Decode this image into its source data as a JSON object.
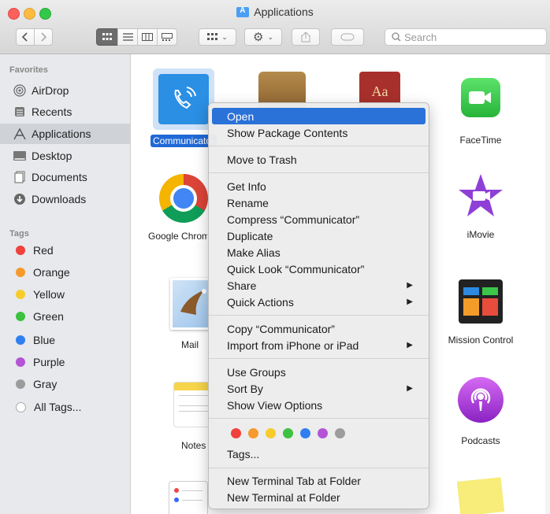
{
  "window": {
    "title": "Applications"
  },
  "toolbar": {
    "search_placeholder": "Search"
  },
  "sidebar": {
    "favorites_header": "Favorites",
    "favorites": [
      {
        "label": "AirDrop",
        "icon": "airdrop-icon"
      },
      {
        "label": "Recents",
        "icon": "recents-icon"
      },
      {
        "label": "Applications",
        "icon": "applications-icon",
        "selected": true
      },
      {
        "label": "Desktop",
        "icon": "desktop-icon"
      },
      {
        "label": "Documents",
        "icon": "documents-icon"
      },
      {
        "label": "Downloads",
        "icon": "downloads-icon"
      }
    ],
    "tags_header": "Tags",
    "tags": [
      {
        "label": "Red",
        "color": "#f0413c"
      },
      {
        "label": "Orange",
        "color": "#f69a2d"
      },
      {
        "label": "Yellow",
        "color": "#f7cc2b"
      },
      {
        "label": "Green",
        "color": "#3cc141"
      },
      {
        "label": "Blue",
        "color": "#2f7ff1"
      },
      {
        "label": "Purple",
        "color": "#b454d7"
      },
      {
        "label": "Gray",
        "color": "#9c9c9c"
      },
      {
        "label": "All Tags...",
        "color": "#c8c8c8"
      }
    ]
  },
  "apps": [
    {
      "label": "Communicator",
      "icon": "communicator-icon",
      "selected": true
    },
    {
      "label": "FaceTime",
      "icon": "facetime-icon"
    },
    {
      "label": "Google Chrome",
      "icon": "chrome-icon"
    },
    {
      "label": "iMovie",
      "icon": "imovie-icon"
    },
    {
      "label": "Mail",
      "icon": "mail-icon"
    },
    {
      "label": "Mission Control",
      "icon": "mission-control-icon"
    },
    {
      "label": "Notes",
      "icon": "notes-icon"
    },
    {
      "label": "Podcasts",
      "icon": "podcasts-icon"
    }
  ],
  "context_menu": {
    "items": [
      "Open",
      "Show Package Contents",
      "Move to Trash",
      "Get Info",
      "Rename",
      "Compress “Communicator”",
      "Duplicate",
      "Make Alias",
      "Quick Look “Communicator”",
      "Share",
      "Quick Actions",
      "Copy “Communicator”",
      "Import from iPhone or iPad",
      "Use Groups",
      "Sort By",
      "Show View Options",
      "Tags...",
      "New Terminal Tab at Folder",
      "New Terminal at Folder"
    ],
    "tag_colors": [
      "#f0413c",
      "#f69a2d",
      "#f7cc2b",
      "#3cc141",
      "#2f7ff1",
      "#b454d7",
      "#9c9c9c"
    ]
  }
}
